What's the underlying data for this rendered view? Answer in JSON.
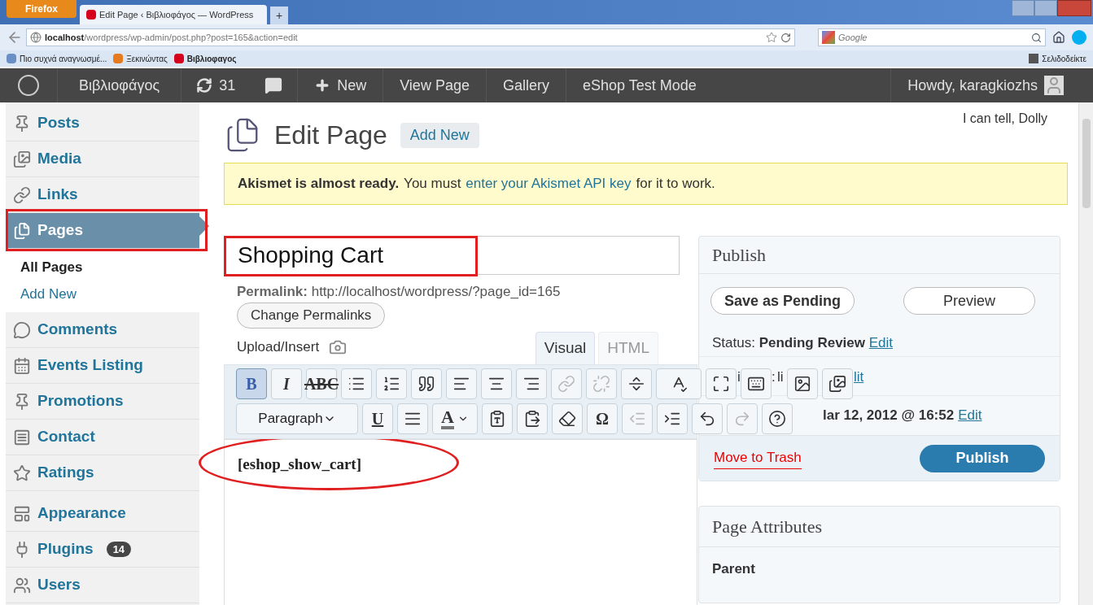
{
  "browser": {
    "menu_button": "Firefox",
    "tabs": [
      {
        "label": "Edit Page ‹ Βιβλιοφάγος — WordPress",
        "selected": true
      }
    ],
    "new_tab": "+",
    "url_host": "localhost",
    "url_path": "/wordpress/wp-admin/post.php?post=165&action=edit",
    "search_placeholder": "Google",
    "bookmarks": [
      "Πιο συχνά αναγνωσμέ...",
      "Ξεκινώντας",
      "Βιβλιοφαγος"
    ],
    "bookmarks_menu": "Σελιδοδείκτε"
  },
  "admin_bar": {
    "site": "Βιβλιοφάγος",
    "updates": "31",
    "new": "New",
    "items": [
      "View Page",
      "Gallery",
      "eShop Test Mode"
    ],
    "howdy": "Howdy, karagkiozhs"
  },
  "sidebar": {
    "items": [
      {
        "kind": "posts",
        "label": "Posts",
        "selected": false
      },
      {
        "kind": "media",
        "label": "Media",
        "selected": false
      },
      {
        "kind": "links",
        "label": "Links",
        "selected": false
      },
      {
        "kind": "pages",
        "label": "Pages",
        "selected": true,
        "children": [
          {
            "label": "All Pages",
            "selected": true
          },
          {
            "label": "Add New",
            "selected": false
          }
        ]
      },
      {
        "kind": "comments",
        "label": "Comments",
        "selected": false
      },
      {
        "kind": "events",
        "label": "Events Listing",
        "selected": false
      },
      {
        "kind": "promotions",
        "label": "Promotions",
        "selected": false
      },
      {
        "kind": "contact",
        "label": "Contact",
        "selected": false
      },
      {
        "kind": "ratings",
        "label": "Ratings",
        "selected": false
      },
      {
        "kind": "appearance",
        "label": "Appearance",
        "selected": false
      },
      {
        "kind": "plugins",
        "label": "Plugins",
        "selected": false,
        "badge": "14"
      },
      {
        "kind": "users",
        "label": "Users",
        "selected": false
      }
    ]
  },
  "dolly": "I can tell, Dolly",
  "heading": "Edit Page",
  "add_new": "Add New",
  "notice": {
    "bold": "Akismet is almost ready.",
    "text": "You must",
    "link": "enter your Akismet API key",
    "after": "for it to work."
  },
  "title_value": "Shopping Cart",
  "permalink": {
    "label": "Permalink:",
    "url": "http://localhost/wordpress/?page_id=165",
    "button": "Change Permalinks"
  },
  "upload_insert": "Upload/Insert",
  "editor_tabs": [
    {
      "label": "Visual",
      "selected": true
    },
    {
      "label": "HTML",
      "selected": false
    }
  ],
  "toolbar_rows": [
    [
      {
        "kind": "letter",
        "label": "B",
        "active": true,
        "disabled": false
      },
      {
        "kind": "letter-italic",
        "label": "I",
        "active": false,
        "disabled": false
      },
      {
        "kind": "strike",
        "label": "ABC",
        "active": false,
        "disabled": false
      },
      {
        "kind": "bullets",
        "active": false,
        "disabled": false
      },
      {
        "kind": "numbers",
        "active": false,
        "disabled": false
      },
      {
        "kind": "quote",
        "active": false,
        "disabled": false
      },
      {
        "kind": "align-left",
        "active": false,
        "disabled": false
      },
      {
        "kind": "align-center",
        "active": false,
        "disabled": false
      },
      {
        "kind": "align-right",
        "active": false,
        "disabled": false
      },
      {
        "kind": "link",
        "active": false,
        "disabled": true
      },
      {
        "kind": "unlink",
        "active": false,
        "disabled": true
      },
      {
        "kind": "more",
        "active": false,
        "disabled": false
      },
      {
        "kind": "spell",
        "active": false,
        "disabled": false
      },
      {
        "kind": "fullscreen",
        "active": false,
        "disabled": false
      },
      {
        "kind": "kitchen",
        "active": false,
        "disabled": false
      },
      {
        "kind": "image",
        "active": false,
        "disabled": false
      },
      {
        "kind": "media",
        "active": false,
        "disabled": false
      }
    ],
    [
      {
        "kind": "select",
        "label": "Paragraph",
        "active": false,
        "disabled": false
      },
      {
        "kind": "letter-underline",
        "label": "U",
        "active": false,
        "disabled": false
      },
      {
        "kind": "justify",
        "active": false,
        "disabled": false
      },
      {
        "kind": "color",
        "label": "A",
        "active": false,
        "disabled": false
      },
      {
        "kind": "paste-text",
        "active": false,
        "disabled": false
      },
      {
        "kind": "paste-word",
        "active": false,
        "disabled": false
      },
      {
        "kind": "eraser",
        "active": false,
        "disabled": false
      },
      {
        "kind": "letter",
        "label": "Ω",
        "active": false,
        "disabled": false
      },
      {
        "kind": "outdent",
        "active": false,
        "disabled": true
      },
      {
        "kind": "indent",
        "active": false,
        "disabled": false
      },
      {
        "kind": "undo",
        "active": false,
        "disabled": false
      },
      {
        "kind": "redo",
        "active": false,
        "disabled": true
      },
      {
        "kind": "help",
        "active": false,
        "disabled": false
      }
    ]
  ],
  "content": "[eshop_show_cart]",
  "publish": {
    "title": "Publish",
    "save": "Save as Pending",
    "preview": "Preview",
    "status_label": "Status:",
    "status": "Pending Review",
    "status_edit": "Edit",
    "visibility_fragments": [
      "i",
      ":",
      "li",
      "lit"
    ],
    "schedule": "lar 12, 2012 @ 16:52",
    "schedule_edit": "Edit",
    "trash": "Move to Trash",
    "publish": "Publish"
  },
  "page_attributes": {
    "title": "Page Attributes",
    "parent": "Parent"
  }
}
